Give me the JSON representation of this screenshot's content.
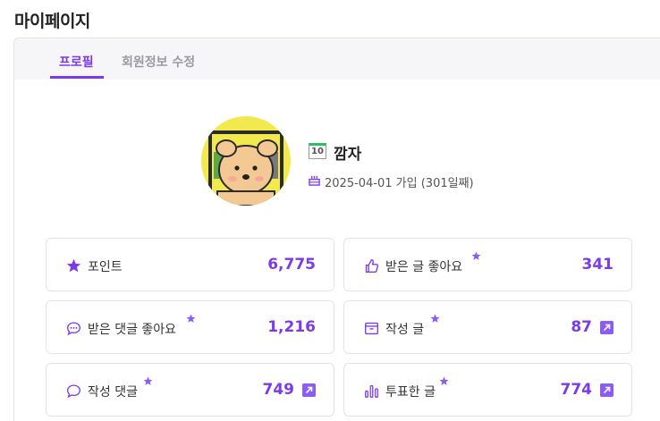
{
  "page_title": "마이페이지",
  "tabs": [
    {
      "label": "프로필",
      "active": true
    },
    {
      "label": "회원정보 수정",
      "active": false
    }
  ],
  "profile": {
    "level": "10",
    "username": "깜자",
    "joined": "2025-04-01 가입 (301일째)"
  },
  "stats": [
    {
      "label": "포인트",
      "value": "6,775",
      "icon": "star-icon",
      "starred": false,
      "has_link": false
    },
    {
      "label": "받은 글 좋아요",
      "value": "341",
      "icon": "thumbs-up-icon",
      "starred": true,
      "has_link": false
    },
    {
      "label": "받은 댓글 좋아요",
      "value": "1,216",
      "icon": "comment-dots-icon",
      "starred": true,
      "has_link": false
    },
    {
      "label": "작성 글",
      "value": "87",
      "icon": "archive-icon",
      "starred": true,
      "has_link": true
    },
    {
      "label": "작성 댓글",
      "value": "749",
      "icon": "comment-icon",
      "starred": true,
      "has_link": true
    },
    {
      "label": "투표한 글",
      "value": "774",
      "icon": "bar-chart-icon",
      "starred": true,
      "has_link": true
    }
  ],
  "colors": {
    "accent": "#7c3aed",
    "level_badge": "#22c55e"
  }
}
